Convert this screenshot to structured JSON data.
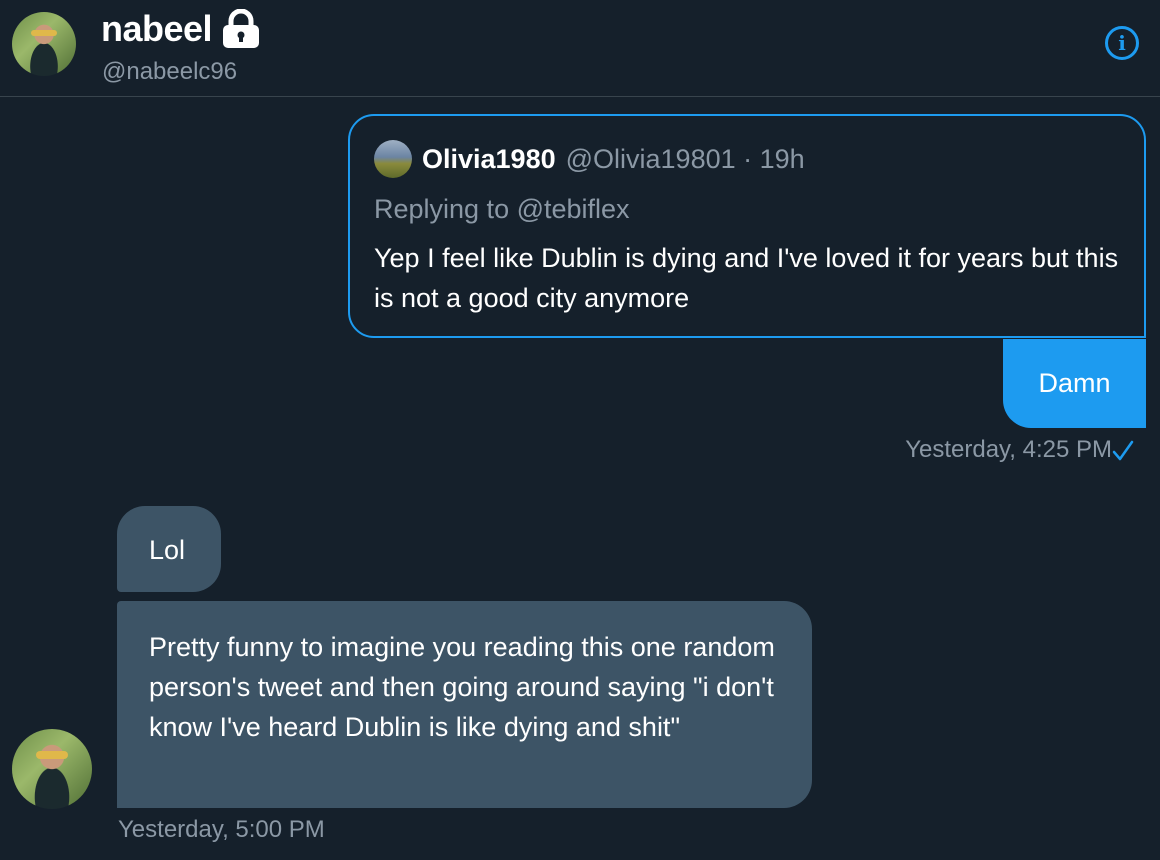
{
  "header": {
    "display_name": "nabeel",
    "handle": "@nabeelc96",
    "lock_icon": "lock-icon",
    "info_icon": "info-icon",
    "info_glyph": "i"
  },
  "quoted_tweet": {
    "author_name": "Olivia1980",
    "author_meta": "@Olivia19801 · 19h",
    "replying_to": "Replying to @tebiflex",
    "text": "Yep I feel like Dublin is dying and I've loved it for years but this is not a good city anymore"
  },
  "messages": [
    {
      "direction": "sent",
      "text": "Damn",
      "timestamp": "Yesterday, 4:25 PM",
      "status": "read-check-icon"
    },
    {
      "direction": "received",
      "text": "Lol"
    },
    {
      "direction": "received",
      "text": "Pretty funny to imagine you reading this one random person's tweet and then going around saying \"i don't know I've heard Dublin is like dying and shit\"",
      "timestamp": "Yesterday, 5:00 PM"
    }
  ],
  "colors": {
    "background": "#15202b",
    "accent": "#1d9bf0",
    "received_bubble": "#3d5466",
    "muted_text": "#8b98a5"
  }
}
